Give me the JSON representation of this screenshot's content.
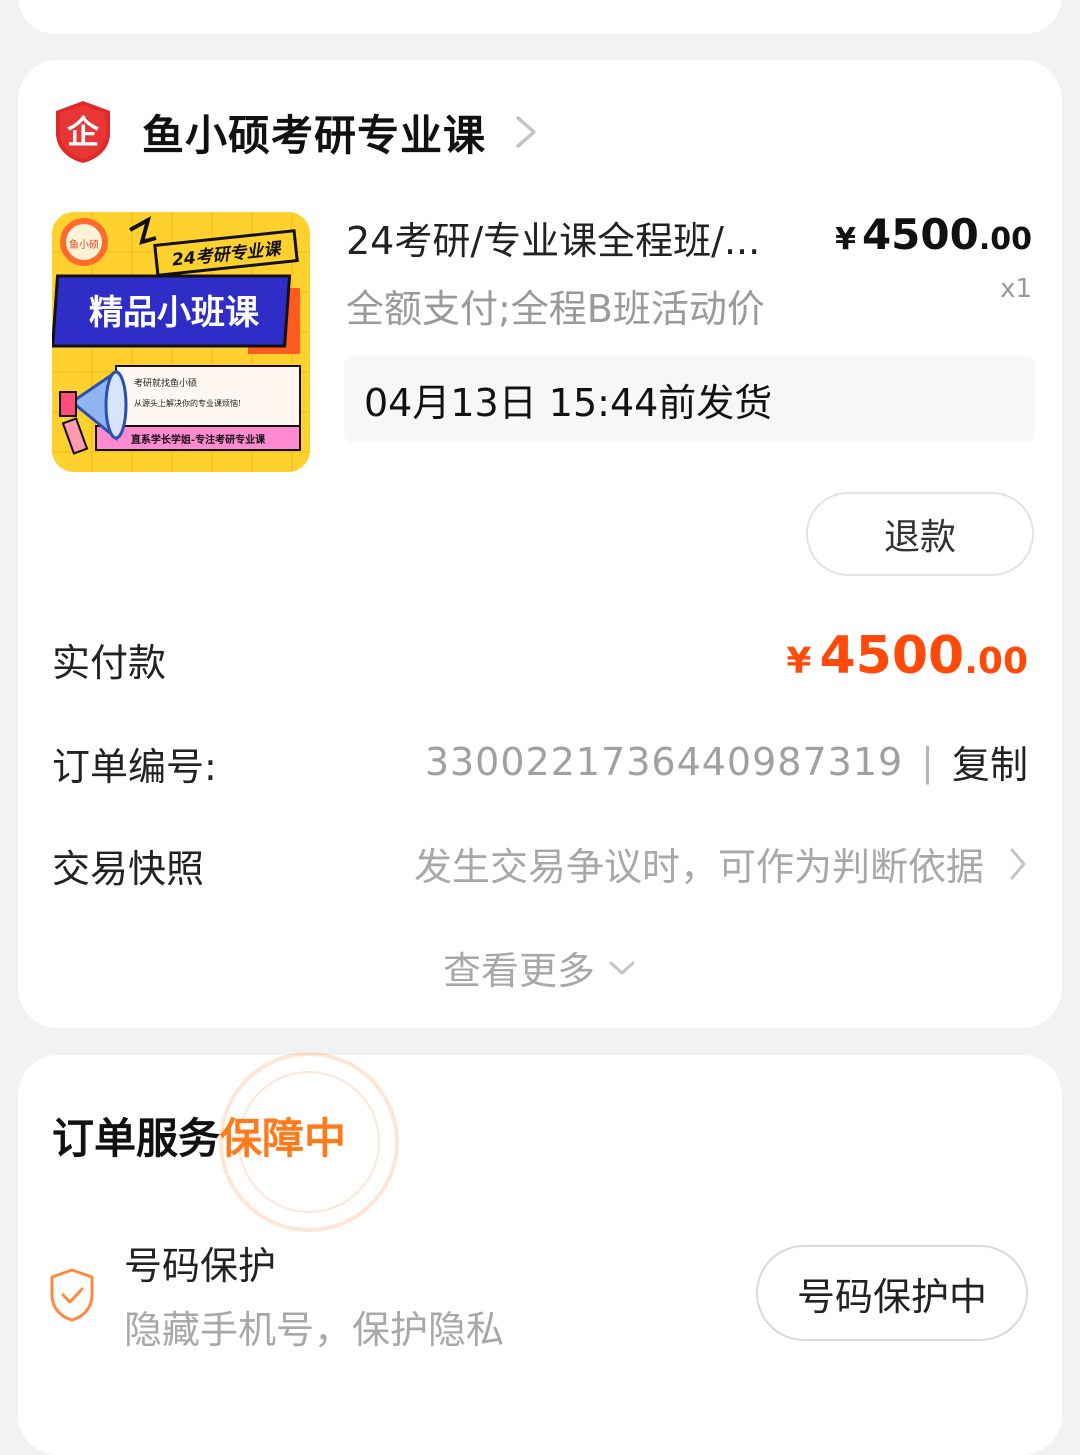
{
  "shop": {
    "badge_char": "企",
    "name": "鱼小硕考研专业课"
  },
  "product": {
    "thumb": {
      "logo_text": "鱼小硕",
      "tag": "24考研专业课",
      "headline": "精品小班课",
      "line1": "考研就找鱼小硕",
      "line2": "从源头上解决你的专业课烦恼!",
      "banner": "直系学长学姐-专注考研专业课"
    },
    "title": "24考研/专业课全程班/...",
    "subtitle": "全额支付;全程B班活动价",
    "price_symbol": "¥",
    "price_int": "4500",
    "price_dec": ".00",
    "qty": "x1",
    "ship_notice": "04月13日 15:44前发货",
    "refund_label": "退款"
  },
  "payment": {
    "label": "实付款",
    "symbol": "¥",
    "amount_int": "4500",
    "amount_dec": ".00"
  },
  "order_no": {
    "label": "订单编号:",
    "value": "3300221736440987319",
    "separator": "|",
    "copy_label": "复制"
  },
  "snapshot": {
    "label": "交易快照",
    "hint": "发生交易争议时，可作为判断依据"
  },
  "more": {
    "label": "查看更多"
  },
  "service": {
    "title": "订单服务",
    "status": "保障中",
    "item_name": "号码保护",
    "item_desc": "隐藏手机号，保护隐私",
    "item_button": "号码保护中"
  },
  "colors": {
    "accent_price": "#ff4a0a",
    "accent_status": "#ff7a1a",
    "shop_badge": "#e02a2a"
  },
  "icons": {
    "shop_badge": "enterprise-shield-icon",
    "shop_chevron": "chevron-right-icon",
    "snapshot_chevron": "chevron-right-icon",
    "more_chevron": "chevron-down-icon",
    "service_icon": "shield-check-icon"
  }
}
